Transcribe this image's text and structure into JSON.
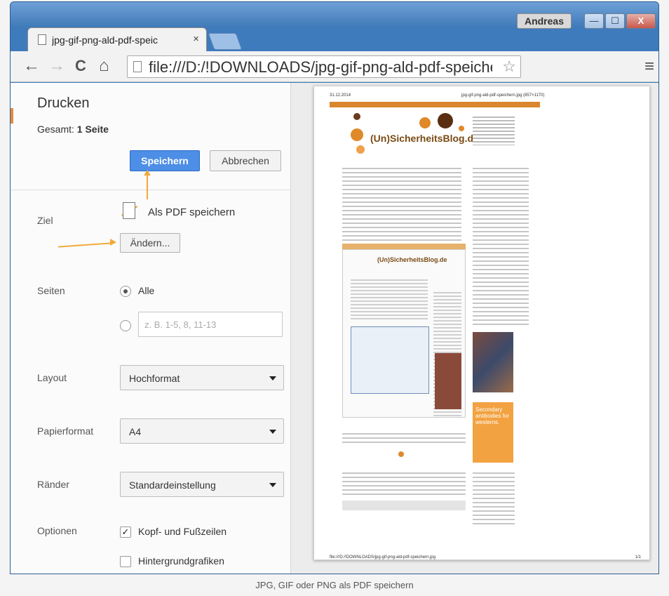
{
  "window": {
    "user": "Andreas",
    "controls": {
      "minimize": "—",
      "maximize": "☐",
      "close": "X"
    }
  },
  "tab": {
    "title": "jpg-gif-png-ald-pdf-speic",
    "close": "×"
  },
  "toolbar": {
    "back": "←",
    "forward": "→",
    "reload": "C",
    "home": "⌂",
    "url": "file:///D:/!DOWNLOADS/jpg-gif-png-ald-pdf-speichern",
    "star": "☆",
    "menu": "≡"
  },
  "print": {
    "title": "Drucken",
    "total_label": "Gesamt:",
    "total_value": "1 Seite",
    "save_button": "Speichern",
    "cancel_button": "Abbrechen",
    "destination": {
      "label": "Ziel",
      "value": "Als PDF speichern",
      "change_button": "Ändern..."
    },
    "pages": {
      "label": "Seiten",
      "all": "Alle",
      "custom_placeholder": "z. B. 1-5, 8, 11-13"
    },
    "layout": {
      "label": "Layout",
      "value": "Hochformat"
    },
    "paper": {
      "label": "Papierformat",
      "value": "A4"
    },
    "margins": {
      "label": "Ränder",
      "value": "Standardeinstellung"
    },
    "options": {
      "label": "Optionen",
      "header_footer": "Kopf- und Fußzeilen",
      "header_footer_checked": true,
      "background": "Hintergrundgrafiken",
      "background_checked": false
    }
  },
  "preview": {
    "date": "31.12.2014",
    "header": "jpg-gif-png-ald-pdf-speichern.jpg (857×1170)",
    "footer": "file:///D:/!DOWNLOADS/jpg-gif-png-ald-pdf-speichern.jpg",
    "page_num": "1/1",
    "logo": "(Un)SicherheitsBlog.de",
    "ad_text": "Secondary antibodies for westerns."
  },
  "caption": "JPG, GIF oder PNG als PDF speichern",
  "colors": {
    "accent": "#4d8ee6",
    "arrow": "#f2a93b",
    "brand": "#d9862e"
  }
}
